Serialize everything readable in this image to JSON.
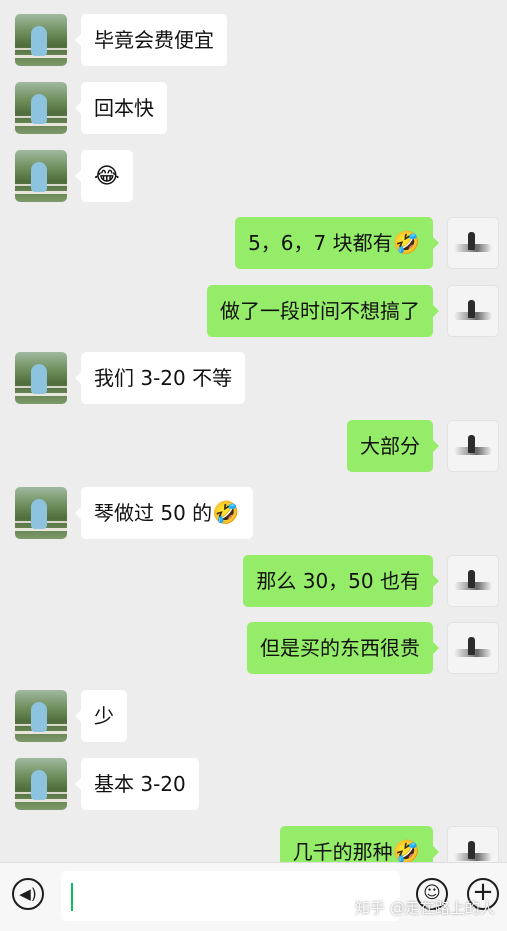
{
  "messages": [
    {
      "side": "left",
      "text": "毕竟会费便宜",
      "emoji": ""
    },
    {
      "side": "left",
      "text": "回本快",
      "emoji": ""
    },
    {
      "side": "left",
      "text": "",
      "emoji": "😂"
    },
    {
      "side": "right",
      "text": "5，6，7 块都有",
      "emoji": "🤣"
    },
    {
      "side": "right",
      "text": "做了一段时间不想搞了",
      "emoji": ""
    },
    {
      "side": "left",
      "text": "我们 3-20 不等",
      "emoji": ""
    },
    {
      "side": "right",
      "text": "大部分",
      "emoji": ""
    },
    {
      "side": "left",
      "text": "琴做过 50 的",
      "emoji": "🤣"
    },
    {
      "side": "right",
      "text": "那么 30，50 也有",
      "emoji": ""
    },
    {
      "side": "right",
      "text": "但是买的东西很贵",
      "emoji": ""
    },
    {
      "side": "left",
      "text": "少",
      "emoji": ""
    },
    {
      "side": "left",
      "text": "基本 3-20",
      "emoji": ""
    },
    {
      "side": "right",
      "text": "几千的那种",
      "emoji": "🤣"
    }
  ],
  "input_bar": {
    "voice_icon": "voice-icon",
    "input_value": "",
    "emoji_icon": "emoji-face-icon",
    "plus_icon": "plus-icon"
  },
  "watermark": "知乎 @走在路上的人",
  "colors": {
    "background": "#ededed",
    "outgoing_bubble": "#95ec69",
    "incoming_bubble": "#ffffff",
    "caret": "#07c160"
  }
}
